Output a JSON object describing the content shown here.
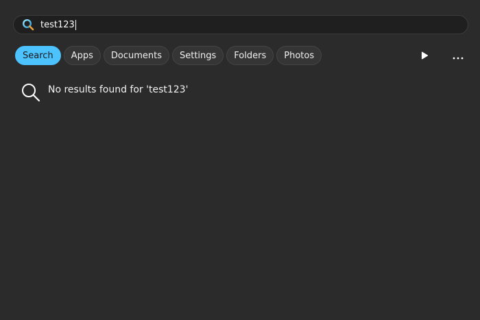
{
  "search": {
    "query": "test123",
    "icon": "search-icon",
    "accent_color": "#4cc2ff"
  },
  "filters": {
    "active": "Search",
    "items": [
      {
        "label": "Search"
      },
      {
        "label": "Apps"
      },
      {
        "label": "Documents"
      },
      {
        "label": "Settings"
      },
      {
        "label": "Folders"
      },
      {
        "label": "Photos"
      }
    ]
  },
  "toolbar": {
    "play_icon": "play-icon",
    "more_icon": "more-icon"
  },
  "results": {
    "message": "No results found for 'test123'",
    "icon": "search-icon"
  }
}
